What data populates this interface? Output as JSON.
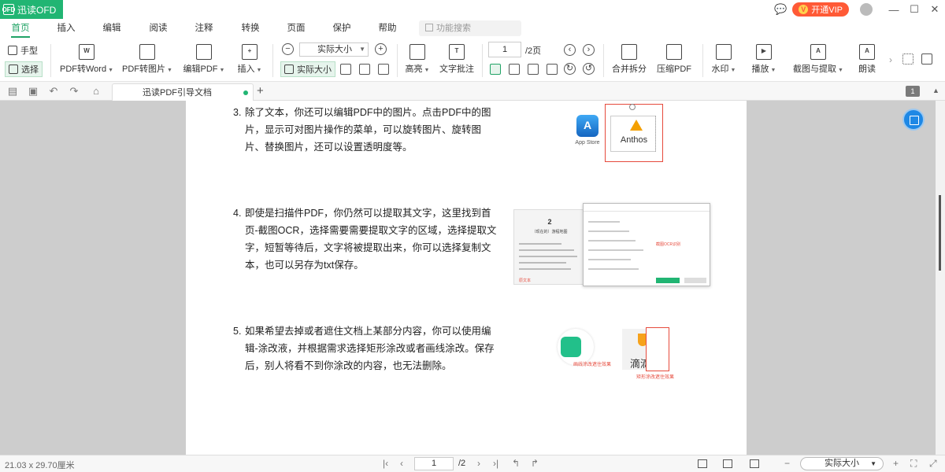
{
  "app": {
    "title": "迅读OFD",
    "logo_mark": "OFD"
  },
  "titlebar": {
    "vip_label": "开通VIP",
    "vip_badge": "V"
  },
  "menu": {
    "tabs": [
      "首页",
      "插入",
      "编辑",
      "阅读",
      "注释",
      "转换",
      "页面",
      "保护",
      "帮助"
    ],
    "active": "首页",
    "search_placeholder": "功能搜索"
  },
  "ribbon": {
    "hand": "手型",
    "select": "选择",
    "pdf_to_word": "PDF转Word",
    "pdf_to_image": "PDF转图片",
    "edit_pdf": "编辑PDF",
    "insert": "插入",
    "zoom_value": "实际大小",
    "actual_size": "实际大小",
    "page_value": "1",
    "page_total": "/2页",
    "highlight": "高亮",
    "text_note": "文字批注",
    "merge_split": "合并拆分",
    "compress_pdf": "压缩PDF",
    "watermark": "水印",
    "play": "播放",
    "capture_extract": "截图与提取",
    "read_aloud": "朗读"
  },
  "doc_tab": {
    "title": "迅读PDF引导文档"
  },
  "page_badge": "1",
  "document": {
    "paragraphs": [
      {
        "num": "3.",
        "text": "除了文本，你还可以编辑PDF中的图片。点击PDF中的图片，显示可对图片操作的菜单，可以旋转图片、旋转图片、替换图片，还可以设置透明度等。"
      },
      {
        "num": "4.",
        "text": "即使是扫描件PDF，你仍然可以提取其文字，这里找到首页-截图OCR，选择需要需要提取文字的区域，选择提取文字，短暂等待后，文字将被提取出来，你可以选择复制文本，也可以另存为txt保存。"
      },
      {
        "num": "5.",
        "text": "如果希望去掉或者遮住文档上某部分内容，你可以使用编辑-涂改液，并根据需求选择矩形涂改或者画线涂改。保存后，别人将看不到你涂改的内容，也无法删除。"
      }
    ],
    "illustrations": {
      "appstore_label": "App Store",
      "anthos_label": "Anthos",
      "ocr_title": "2",
      "ocr_subtitle": "（现在的）游程地图",
      "ocr_red_left": "原文本",
      "ocr_red_dialog": "截图OCR识别",
      "meituan_label": "画线涂改遮住效果",
      "didi_text": "滴滴",
      "didi_label": "矩形涂改遮住效果"
    }
  },
  "statusbar": {
    "page_size": "21.03 x 29.70厘米",
    "page_value": "1",
    "page_total": "/2",
    "zoom_value": "实际大小"
  }
}
